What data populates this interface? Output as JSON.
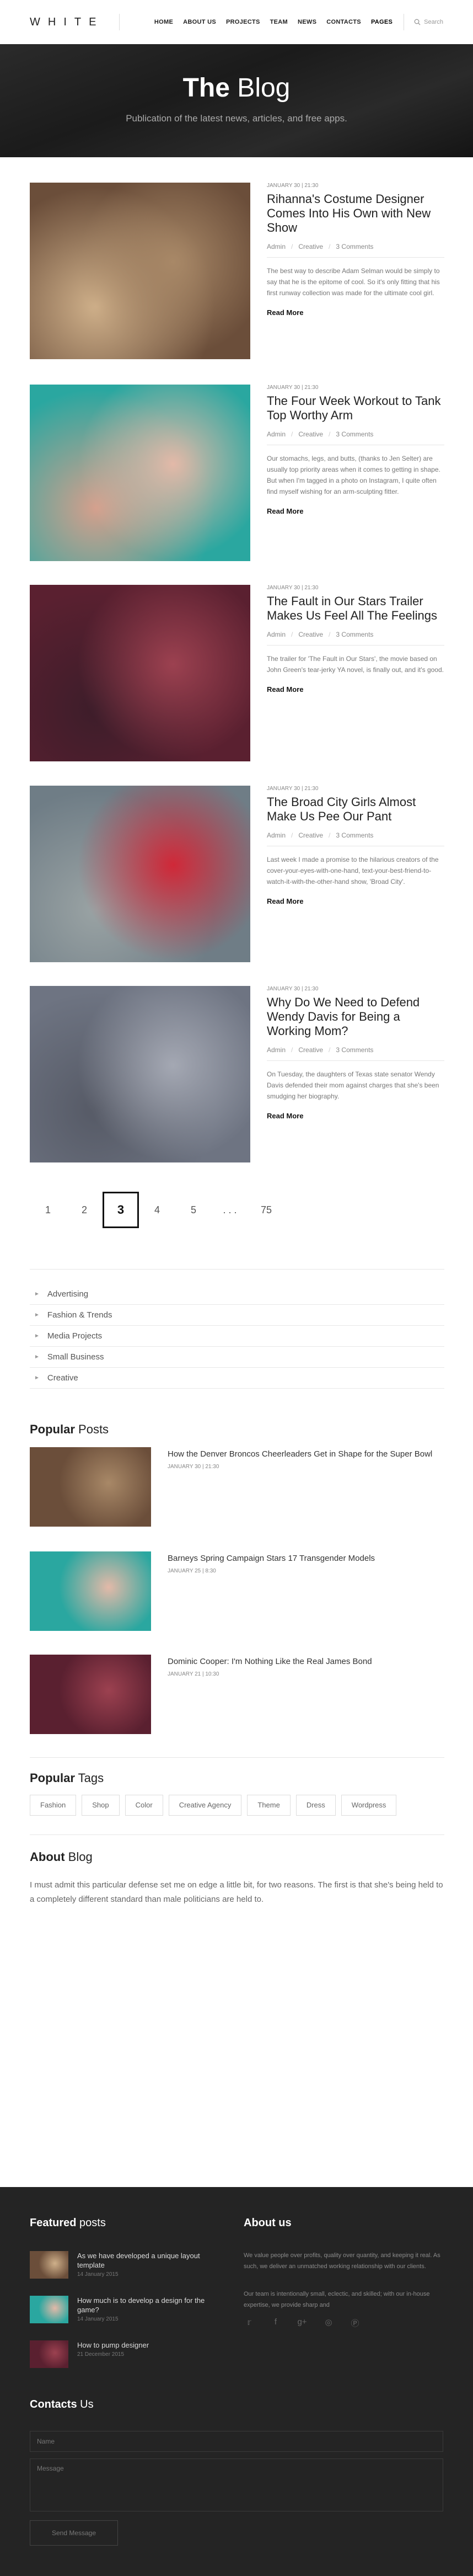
{
  "header": {
    "logo": "WHITE",
    "nav": [
      "HOME",
      "ABOUT US",
      "PROJECTS",
      "TEAM",
      "NEWS",
      "CONTACTS",
      "PAGES"
    ],
    "active_nav": "PAGES",
    "search_placeholder": "Search"
  },
  "hero": {
    "title_bold": "The",
    "title_rest": "Blog",
    "subtitle": "Publication of the latest news, articles, and free apps."
  },
  "posts": [
    {
      "date": "JANUARY 30 | 21:30",
      "title": "Rihanna's Costume Designer Comes Into His Own with New Show",
      "author": "Admin",
      "category": "Creative",
      "comments": "3 Comments",
      "excerpt": "The best way to describe Adam Selman would be simply to say that he is the epitome of cool. So it's only fitting that his first runway collection was made for the ultimate cool girl.",
      "more": "Read More",
      "palette": [
        "#6b4e3a",
        "#a88867",
        "#cfb08a"
      ]
    },
    {
      "date": "JANUARY 30 | 21:30",
      "title": "The Four Week Workout to Tank Top Worthy Arm",
      "author": "Admin",
      "category": "Creative",
      "comments": "3 Comments",
      "excerpt": "Our stomachs, legs, and butts, (thanks to Jen Selter) are usually top priority areas when it comes to getting in shape. But when I'm tagged in a photo on Instagram, I quite often find myself wishing for an arm-sculpting fitter.",
      "more": "Read More",
      "palette": [
        "#2aa7a0",
        "#e3b9a8",
        "#d49f8c"
      ]
    },
    {
      "date": "JANUARY 30 | 21:30",
      "title": "The Fault in Our Stars Trailer Makes Us Feel All The Feelings",
      "author": "Admin",
      "category": "Creative",
      "comments": "3 Comments",
      "excerpt": "The trailer for 'The Fault in Our Stars', the movie based on John Green's tear-jerky YA novel, is finally out, and it's good.",
      "more": "Read More",
      "palette": [
        "#5a2030",
        "#9c4150",
        "#3d1d2a"
      ]
    },
    {
      "date": "JANUARY 30 | 21:30",
      "title": "The Broad City Girls Almost Make Us Pee Our Pant",
      "author": "Admin",
      "category": "Creative",
      "comments": "3 Comments",
      "excerpt": "Last week I made a promise to the hilarious creators of the cover-your-eyes-with-one-hand, text-your-best-friend-to-watch-it-with-the-other-hand show, 'Broad City'.",
      "more": "Read More",
      "palette": [
        "#6f7d86",
        "#d02838",
        "#9aa3a4"
      ]
    },
    {
      "date": "JANUARY 30 | 21:30",
      "title": "Why Do We Need to Defend Wendy Davis for Being a Working Mom?",
      "author": "Admin",
      "category": "Creative",
      "comments": "3 Comments",
      "excerpt": "On Tuesday, the daughters of Texas state senator Wendy Davis defended their mom against charges that she's been smudging her biography.",
      "more": "Read More",
      "palette": [
        "#6e7482",
        "#a4a8b3",
        "#565a66"
      ]
    }
  ],
  "pagination": [
    "1",
    "2",
    "3",
    "4",
    "5",
    ". . .",
    "75"
  ],
  "current_page": "3",
  "categories": [
    "Advertising",
    "Fashion & Trends",
    "Media Projects",
    "Small Business",
    "Creative"
  ],
  "popular": {
    "title_bold": "Popular",
    "title_rest": "Posts",
    "items": [
      {
        "title": "How the Denver Broncos Cheerleaders Get in Shape for the Super Bowl",
        "date": "JANUARY 30 | 21:30",
        "palette": [
          "#6b4e3a",
          "#a88867"
        ]
      },
      {
        "title": "Barneys Spring Campaign Stars 17 Transgender Models",
        "date": "JANUARY 25 | 8:30",
        "palette": [
          "#2aa7a0",
          "#e3b9a8"
        ]
      },
      {
        "title": "Dominic Cooper: I'm Nothing Like the Real James Bond",
        "date": "JANUARY 21 | 10:30",
        "palette": [
          "#5a2030",
          "#9c4150"
        ]
      }
    ]
  },
  "tags": {
    "title_bold": "Popular",
    "title_rest": "Tags",
    "items": [
      "Fashion",
      "Shop",
      "Color",
      "Creative Agency",
      "Theme",
      "Dress",
      "Wordpress"
    ]
  },
  "about": {
    "title_bold": "About",
    "title_rest": "Blog",
    "text": "I must admit this particular defense set me on edge a little bit, for two reasons. The first is that she's being held to a completely different standard than male politicians are held to."
  },
  "footer": {
    "featured": {
      "title_bold": "Featured",
      "title_rest": "posts",
      "items": [
        {
          "title": "As we have developed a unique layout template",
          "date": "14 January 2015",
          "palette": [
            "#6b4e3a",
            "#cfb08a"
          ]
        },
        {
          "title": "How much is to develop a design for the game?",
          "date": "14 January 2015",
          "palette": [
            "#2aa7a0",
            "#e3b9a8"
          ]
        },
        {
          "title": "How to pump designer",
          "date": "21 December 2015",
          "palette": [
            "#5a2030",
            "#9c4150"
          ]
        }
      ]
    },
    "about": {
      "title": "About us",
      "p1": "We value people over profits, quality over quantity, and keeping it real. As such, we deliver an unmatched working relationship with our clients.",
      "p2": "Our team is intentionally small, eclectic, and skilled; with our in-house expertise, we provide sharp and"
    },
    "socials": [
      "twitter-icon",
      "facebook-icon",
      "google-plus-icon",
      "dribbble-icon",
      "pinterest-icon"
    ],
    "contacts": {
      "title_bold": "Contacts",
      "title_rest": "Us",
      "name_placeholder": "Name",
      "message_placeholder": "Message",
      "button": "Send Message"
    }
  }
}
